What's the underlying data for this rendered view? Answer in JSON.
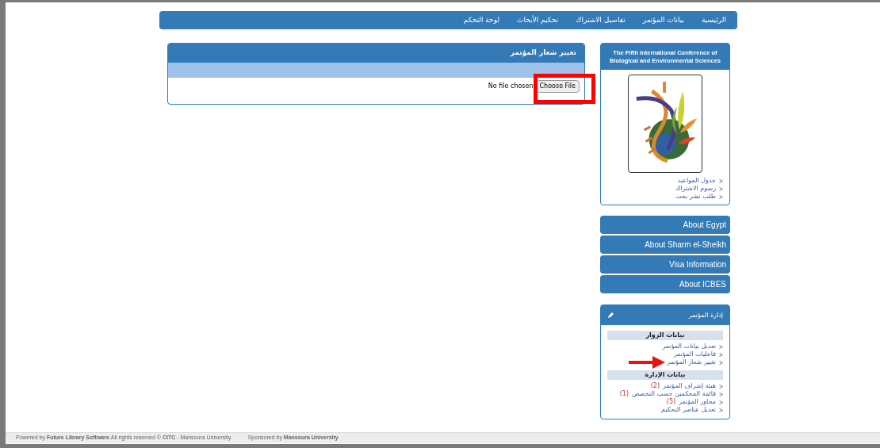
{
  "nav": {
    "items": [
      "الرئيسية",
      "بيانات المؤتمر",
      "تفاصيل الاشتراك",
      "تحكيم الأبحاث",
      "لوحة التحكم"
    ]
  },
  "main_panel": {
    "title": "تغيير شعار المؤتمر",
    "file_input": {
      "button": "Choose File",
      "status": "No file chosen"
    }
  },
  "conference_box": {
    "title": "The Fifth International Conference of Biological and Environmental Sciences",
    "logo": {
      "kind": "picture"
    },
    "links": [
      "جدول المواعيد",
      "رسوم الاشتراك",
      "طلب نشر بحث"
    ]
  },
  "info_buttons": [
    "About Egypt",
    "About Sharm el-Sheikh",
    "Visa Information",
    "About ICBES"
  ],
  "admin_box": {
    "title": "إدارة المؤتمر",
    "sections": [
      {
        "heading": "بيانات الزوار",
        "links": [
          {
            "label": "تعديل بيانات المؤتمر"
          },
          {
            "label": "فاعليات المؤتمر"
          },
          {
            "label": "تغيير شعار المؤتمر"
          }
        ]
      },
      {
        "heading": "بيانات الإدارة",
        "links": [
          {
            "label": "هيئة إشراف المؤتمر",
            "count": "(2)"
          },
          {
            "label": "قائمة المحكمين حسب التخصص",
            "count": "(1)"
          },
          {
            "label": "محاور المؤتمر",
            "count": "(5)"
          },
          {
            "label": "تعديل عناصر التحكيم"
          }
        ]
      }
    ]
  },
  "footer": {
    "credit": "Powered by **Future Library Software**.All rights reserved © **CITC** - Mansoura University.",
    "sponsor": "Sponsored by **Mansoura University**"
  }
}
